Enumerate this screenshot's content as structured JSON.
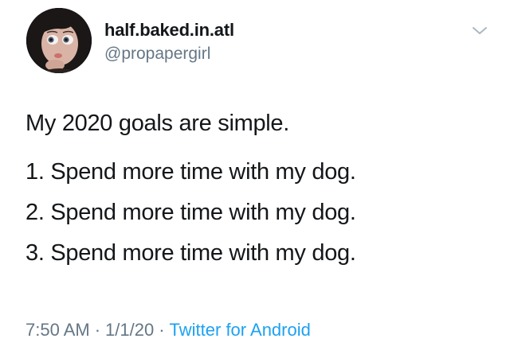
{
  "tweet": {
    "display_name": "half.baked.in.atl",
    "handle": "@propapergirl",
    "avatar": "profile-avatar-cartoon-girl",
    "menu_icon": "chevron-down-icon",
    "body_lines": [
      "My 2020 goals are simple.",
      "1. Spend more time with my dog.",
      "2. Spend more time with my dog.",
      "3. Spend more time with my dog."
    ],
    "time": "7:50 AM",
    "separator": "·",
    "date": "1/1/20",
    "source": "Twitter for Android"
  },
  "colors": {
    "text": "#14171a",
    "secondary_text": "#657786",
    "link": "#1da1f2",
    "background": "#ffffff"
  }
}
